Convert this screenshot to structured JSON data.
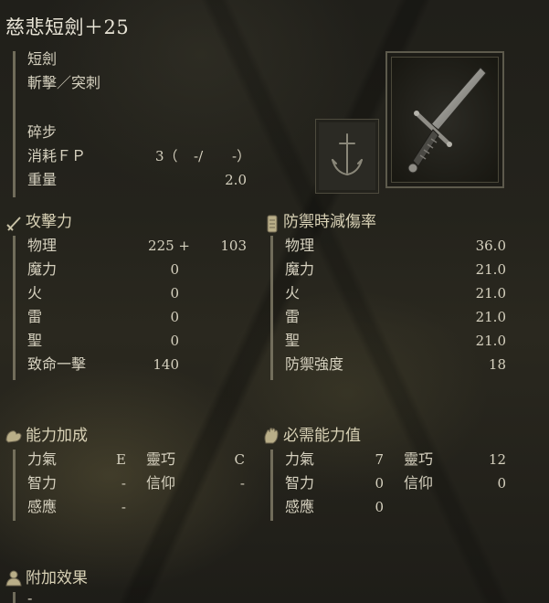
{
  "weapon": {
    "name": "慈悲短劍＋25",
    "type": "短劍",
    "damage_type": "斬擊／突刺",
    "skill": "碎步",
    "fp_label": "消耗ＦＰ",
    "fp_values": [
      "3（",
      "-/",
      "-）"
    ],
    "weight_label": "重量",
    "weight_value": "2.0"
  },
  "attack": {
    "header": "攻擊力",
    "rows": [
      {
        "label": "物理",
        "value": "225 +",
        "bonus": "103"
      },
      {
        "label": "魔力",
        "value": "0",
        "bonus": ""
      },
      {
        "label": "火",
        "value": "0",
        "bonus": ""
      },
      {
        "label": "雷",
        "value": "0",
        "bonus": ""
      },
      {
        "label": "聖",
        "value": "0",
        "bonus": ""
      },
      {
        "label": "致命一擊",
        "value": "140",
        "bonus": ""
      }
    ]
  },
  "guard": {
    "header": "防禦時減傷率",
    "rows": [
      {
        "label": "物理",
        "value": "36.0"
      },
      {
        "label": "魔力",
        "value": "21.0"
      },
      {
        "label": "火",
        "value": "21.0"
      },
      {
        "label": "雷",
        "value": "21.0"
      },
      {
        "label": "聖",
        "value": "21.0"
      },
      {
        "label": "防禦強度",
        "value": "18"
      }
    ]
  },
  "scaling": {
    "header": "能力加成",
    "rows": [
      {
        "a_label": "力氣",
        "a_value": "E",
        "b_label": "靈巧",
        "b_value": "C"
      },
      {
        "a_label": "智力",
        "a_value": "-",
        "b_label": "信仰",
        "b_value": "-"
      },
      {
        "a_label": "感應",
        "a_value": "-",
        "b_label": "",
        "b_value": ""
      }
    ]
  },
  "requirements": {
    "header": "必需能力值",
    "rows": [
      {
        "a_label": "力氣",
        "a_value": "7",
        "b_label": "靈巧",
        "b_value": "12"
      },
      {
        "a_label": "智力",
        "a_value": "0",
        "b_label": "信仰",
        "b_value": "0"
      },
      {
        "a_label": "感應",
        "a_value": "0",
        "b_label": "",
        "b_value": ""
      }
    ]
  },
  "effects": {
    "header": "附加效果",
    "value": "-"
  },
  "icons": {
    "attack": "sword-icon",
    "guard": "shield-icon",
    "scaling": "arm-icon",
    "requirements": "hand-icon",
    "effects": "bust-icon",
    "weapon": "dagger-icon",
    "ash": "anchor-icon"
  }
}
